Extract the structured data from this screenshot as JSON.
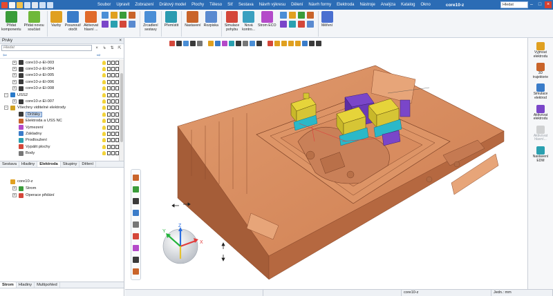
{
  "window": {
    "title": "core10-z",
    "search_placeholder": "Hledat"
  },
  "colors": {
    "titlebar": "#2b6cb5",
    "mold": "#d98a5c",
    "electrode_yellow": "#e6d43a",
    "electrode_purple": "#7a46c9",
    "electrode_cyan": "#2bb8c9"
  },
  "menu": [
    "Soubor",
    "Upravit",
    "Zobrazení",
    "Drátový model",
    "Plochy",
    "Těleso",
    "Síť",
    "Sestava",
    "Návrh výkresu",
    "Dělení",
    "Návrh formy",
    "Elektroda",
    "Nástroje",
    "Analýza",
    "Katalog",
    "Okno"
  ],
  "ribbon": {
    "buttons": [
      {
        "label": "Přidat\nkomponentu",
        "icon": "add-component-icon"
      },
      {
        "label": "Přidat novou\nsoučást",
        "icon": "add-part-icon"
      },
      {
        "label": "Vazby",
        "icon": "constraints-icon"
      },
      {
        "label": "Posunout/\notočit",
        "icon": "move-rotate-icon"
      },
      {
        "label": "Aktivovat\nhlavní ...",
        "icon": "activate-main-icon"
      },
      {
        "label": "Zrcadlení\nsestavy",
        "icon": "mirror-assembly-icon"
      },
      {
        "label": "Přemístit",
        "icon": "relocate-icon"
      },
      {
        "label": "Nastavení",
        "icon": "settings-icon"
      },
      {
        "label": "Rozpiska",
        "icon": "bom-icon"
      },
      {
        "label": "Simulace\npohybu",
        "icon": "motion-sim-icon"
      },
      {
        "label": "Nová\nkontro...",
        "icon": "new-check-icon"
      },
      {
        "label": "Strom ECO",
        "icon": "eco-tree-icon"
      },
      {
        "label": "Měření",
        "icon": "measure-icon"
      }
    ]
  },
  "left_panel": {
    "title": "Prvky",
    "filter_placeholder": "Hledat",
    "tree": [
      {
        "label": "core10-z-El-003",
        "indent": 1,
        "expander": "+",
        "icon": "electrode-icon"
      },
      {
        "label": "core10-z-El-004",
        "indent": 1,
        "expander": "+",
        "icon": "electrode-icon"
      },
      {
        "label": "core10-z-El-005",
        "indent": 1,
        "expander": "+",
        "icon": "electrode-icon"
      },
      {
        "label": "core10-z-El-006",
        "indent": 1,
        "expander": "+",
        "icon": "electrode-icon"
      },
      {
        "label": "core10-z-El-008",
        "indent": 1,
        "expander": "+",
        "icon": "electrode-icon"
      },
      {
        "label": "USS2",
        "indent": 0,
        "expander": "−",
        "icon": "group-icon"
      },
      {
        "label": "core10-z-El-007",
        "indent": 1,
        "expander": "+",
        "icon": "electrode-icon"
      },
      {
        "label": "Všechny viditelné elektrody",
        "indent": 0,
        "expander": "−",
        "icon": "electrodes-all-icon"
      },
      {
        "label": "Držáky",
        "indent": 1,
        "expander": "",
        "icon": "holder-icon",
        "selected": true
      },
      {
        "label": "Elektroda a USS NC",
        "indent": 1,
        "expander": "",
        "icon": "nc-icon"
      },
      {
        "label": "Vymezení",
        "indent": 1,
        "expander": "",
        "icon": "boundary-icon"
      },
      {
        "label": "Základny",
        "indent": 1,
        "expander": "",
        "icon": "base-icon"
      },
      {
        "label": "Prodloužení",
        "indent": 1,
        "expander": "",
        "icon": "extension-icon"
      },
      {
        "label": "Vypálit plochy",
        "indent": 1,
        "expander": "",
        "icon": "burn-faces-icon"
      },
      {
        "label": "Body",
        "indent": 1,
        "expander": "",
        "icon": "points-icon"
      }
    ],
    "tabs_top": [
      "Sestava",
      "Hladiny",
      "Elektroda",
      "Skupiny",
      "Dělení"
    ],
    "tabs_top_active": 2,
    "tree2": [
      {
        "label": "core10-z",
        "indent": 0,
        "expander": "",
        "icon": "part-icon"
      },
      {
        "label": "Strom",
        "indent": 1,
        "expander": "+",
        "icon": "tree-icon"
      },
      {
        "label": "Operace přidání",
        "indent": 1,
        "expander": "+",
        "icon": "add-op-icon"
      }
    ],
    "tabs_bottom": [
      "Strom",
      "Hladiny",
      "Multipohled"
    ],
    "tabs_bottom_active": 0
  },
  "right_panel": [
    {
      "label": "Vyjmout\nelektrodu",
      "icon": "extract-electrode-icon",
      "enabled": true
    },
    {
      "label": "3D\ntrajektorie",
      "icon": "trajectory-3d-icon",
      "enabled": true
    },
    {
      "label": "Simulace\nelektrod",
      "icon": "electrode-sim-icon",
      "enabled": true
    },
    {
      "label": "Aktivovat\nelektrodu",
      "icon": "activate-electrode-icon",
      "enabled": true
    },
    {
      "label": "Aktivovat\nhlavní...",
      "icon": "activate-main-2-icon",
      "enabled": false
    },
    {
      "label": "Nastavení\nEDM",
      "icon": "edm-settings-icon",
      "enabled": true
    }
  ],
  "viewport": {
    "triad_labels": {
      "x": "X",
      "y": "Y",
      "z": "Z"
    }
  },
  "statusbar": {
    "part": "core10-z",
    "units": "Jedn.: mm"
  }
}
